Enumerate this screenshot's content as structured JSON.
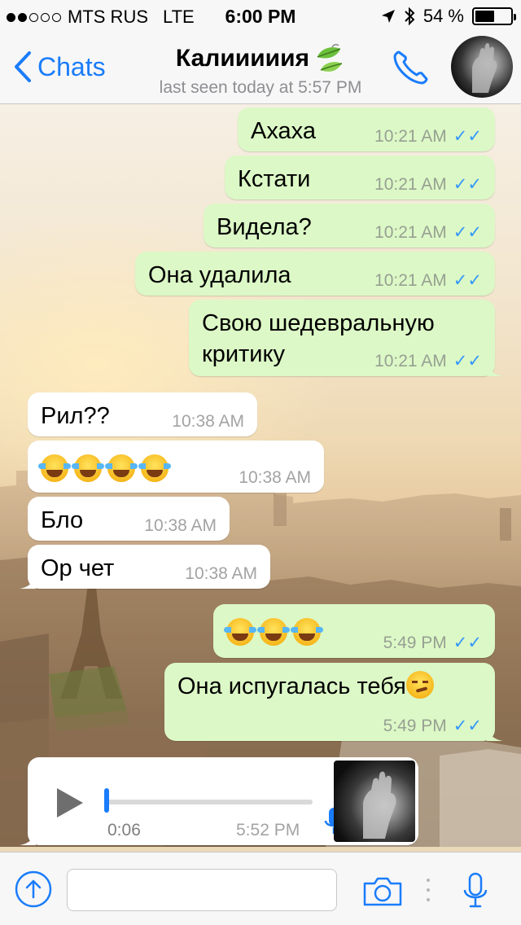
{
  "status_bar": {
    "carrier": "MTS RUS",
    "network": "LTE",
    "time": "6:00 PM",
    "battery": "54 %",
    "battery_level": 0.54
  },
  "header": {
    "back_label": "Chats",
    "contact_name": "Калииииия",
    "last_seen": "last seen today at 5:57 PM"
  },
  "messages": [
    {
      "text": "Ахаха",
      "time": "10:21 AM"
    },
    {
      "text": "Кстати",
      "time": "10:21 AM"
    },
    {
      "text": "Видела?",
      "time": "10:21 AM"
    },
    {
      "text": "Она удалила",
      "time": "10:21 AM"
    },
    {
      "line1": "Свою шедевральную",
      "line2": "критику",
      "time": "10:21 AM"
    },
    {
      "text": "Рил??",
      "time": "10:38 AM"
    },
    {
      "text": "",
      "time": "10:38 AM"
    },
    {
      "text": "Бло",
      "time": "10:38 AM"
    },
    {
      "text": "Ор чет",
      "time": "10:38 AM"
    },
    {
      "text": "",
      "time": "5:49 PM"
    },
    {
      "text": "Она испугалась тебя",
      "time": "5:49 PM"
    }
  ],
  "voice_message": {
    "duration": "0:06",
    "time": "5:52 PM",
    "progress": 0.0
  },
  "input_bar": {
    "text_value": ""
  },
  "colors": {
    "accent": "#1a7cfa",
    "outgoing_bubble": "#dcf8c6",
    "incoming_bubble": "#ffffff",
    "read_ticks": "#3497f9"
  }
}
